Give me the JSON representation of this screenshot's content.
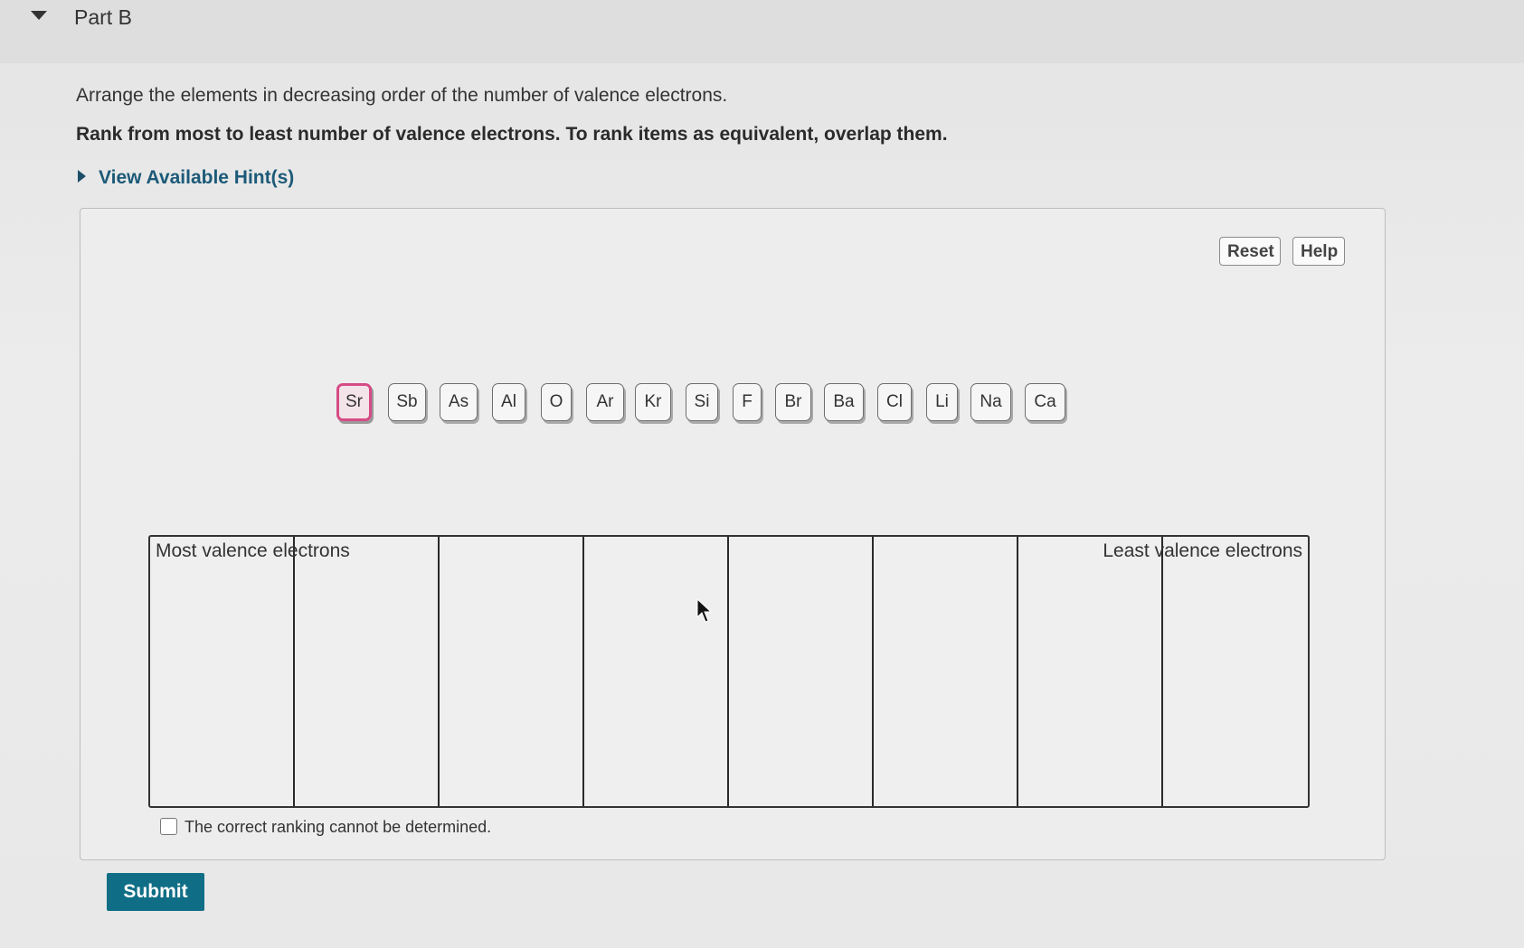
{
  "part": {
    "title": "Part B"
  },
  "question": {
    "instruction": "Arrange the elements in decreasing order of the number of valence electrons.",
    "rank_instruction": "Rank from most to least number of valence electrons. To rank items as equivalent, overlap them.",
    "hints_label": "View Available Hint(s)"
  },
  "controls": {
    "reset_label": "Reset",
    "help_label": "Help"
  },
  "tiles": [
    "Sr",
    "Sb",
    "As",
    "Al",
    "O",
    "Ar",
    "Kr",
    "Si",
    "F",
    "Br",
    "Ba",
    "Cl",
    "Li",
    "Na",
    "Ca"
  ],
  "selected_tile": "Sr",
  "ranking": {
    "most_label": "Most valence electrons",
    "least_label": "Least valence electrons"
  },
  "checkbox": {
    "label": "The correct ranking cannot be determined.",
    "checked": false
  },
  "submit_label": "Submit",
  "colors": {
    "link": "#1c5a78",
    "submit_bg": "#0f6e86",
    "selected_border": "#d64b86"
  }
}
